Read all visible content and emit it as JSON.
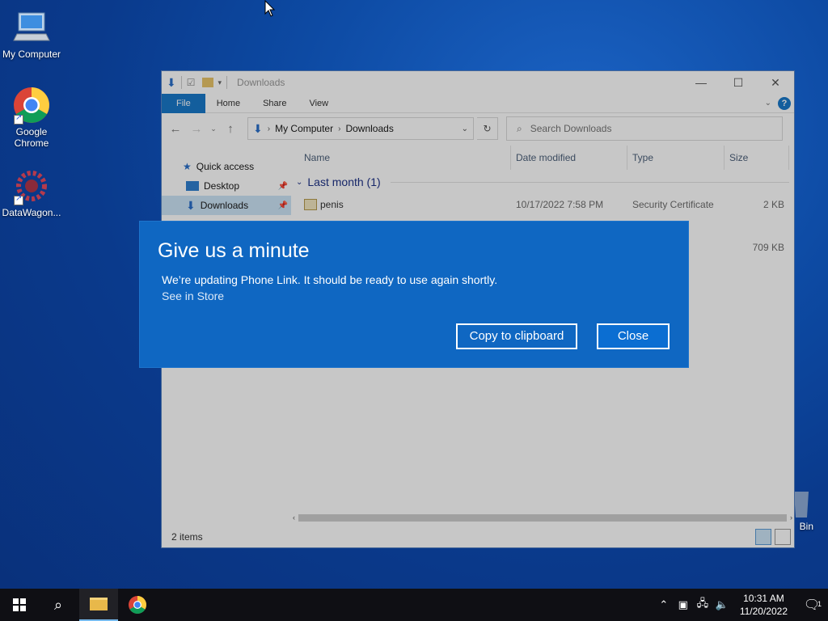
{
  "desktop": {
    "icons": [
      {
        "label": "My Computer",
        "icon": "computer-icon"
      },
      {
        "label": "Google Chrome",
        "icon": "chrome-icon"
      },
      {
        "label": "DataWagon...",
        "icon": "datawagon-icon"
      },
      {
        "label": "Bin",
        "icon": "recycle-bin-icon"
      }
    ]
  },
  "explorer": {
    "title": "Downloads",
    "ribbon_tabs": [
      "File",
      "Home",
      "Share",
      "View"
    ],
    "address": {
      "crumbs": [
        "My Computer",
        "Downloads"
      ]
    },
    "search_placeholder": "Search Downloads",
    "nav": {
      "quick_access": "Quick access",
      "desktop": "Desktop",
      "downloads": "Downloads"
    },
    "columns": {
      "name": "Name",
      "date": "Date modified",
      "type": "Type",
      "size": "Size"
    },
    "group_label": "Last month (1)",
    "files": [
      {
        "name": "penis",
        "date": "10/17/2022 7:58 PM",
        "type": "Security Certificate",
        "size": "2 KB"
      },
      {
        "name": "",
        "date": "",
        "type": "",
        "size": "709 KB"
      }
    ],
    "status": "2 items"
  },
  "dialog": {
    "title": "Give us a minute",
    "message": "We’re updating Phone Link. It should be ready to use again shortly.",
    "link": "See in Store",
    "copy_label": "Copy to clipboard",
    "close_label": "Close"
  },
  "taskbar": {
    "time": "10:31 AM",
    "date": "11/20/2022",
    "notification_count": "1"
  },
  "colors": {
    "accent": "#0f67c2",
    "taskbar": "#0f0f14",
    "file_tab": "#1979ca"
  }
}
